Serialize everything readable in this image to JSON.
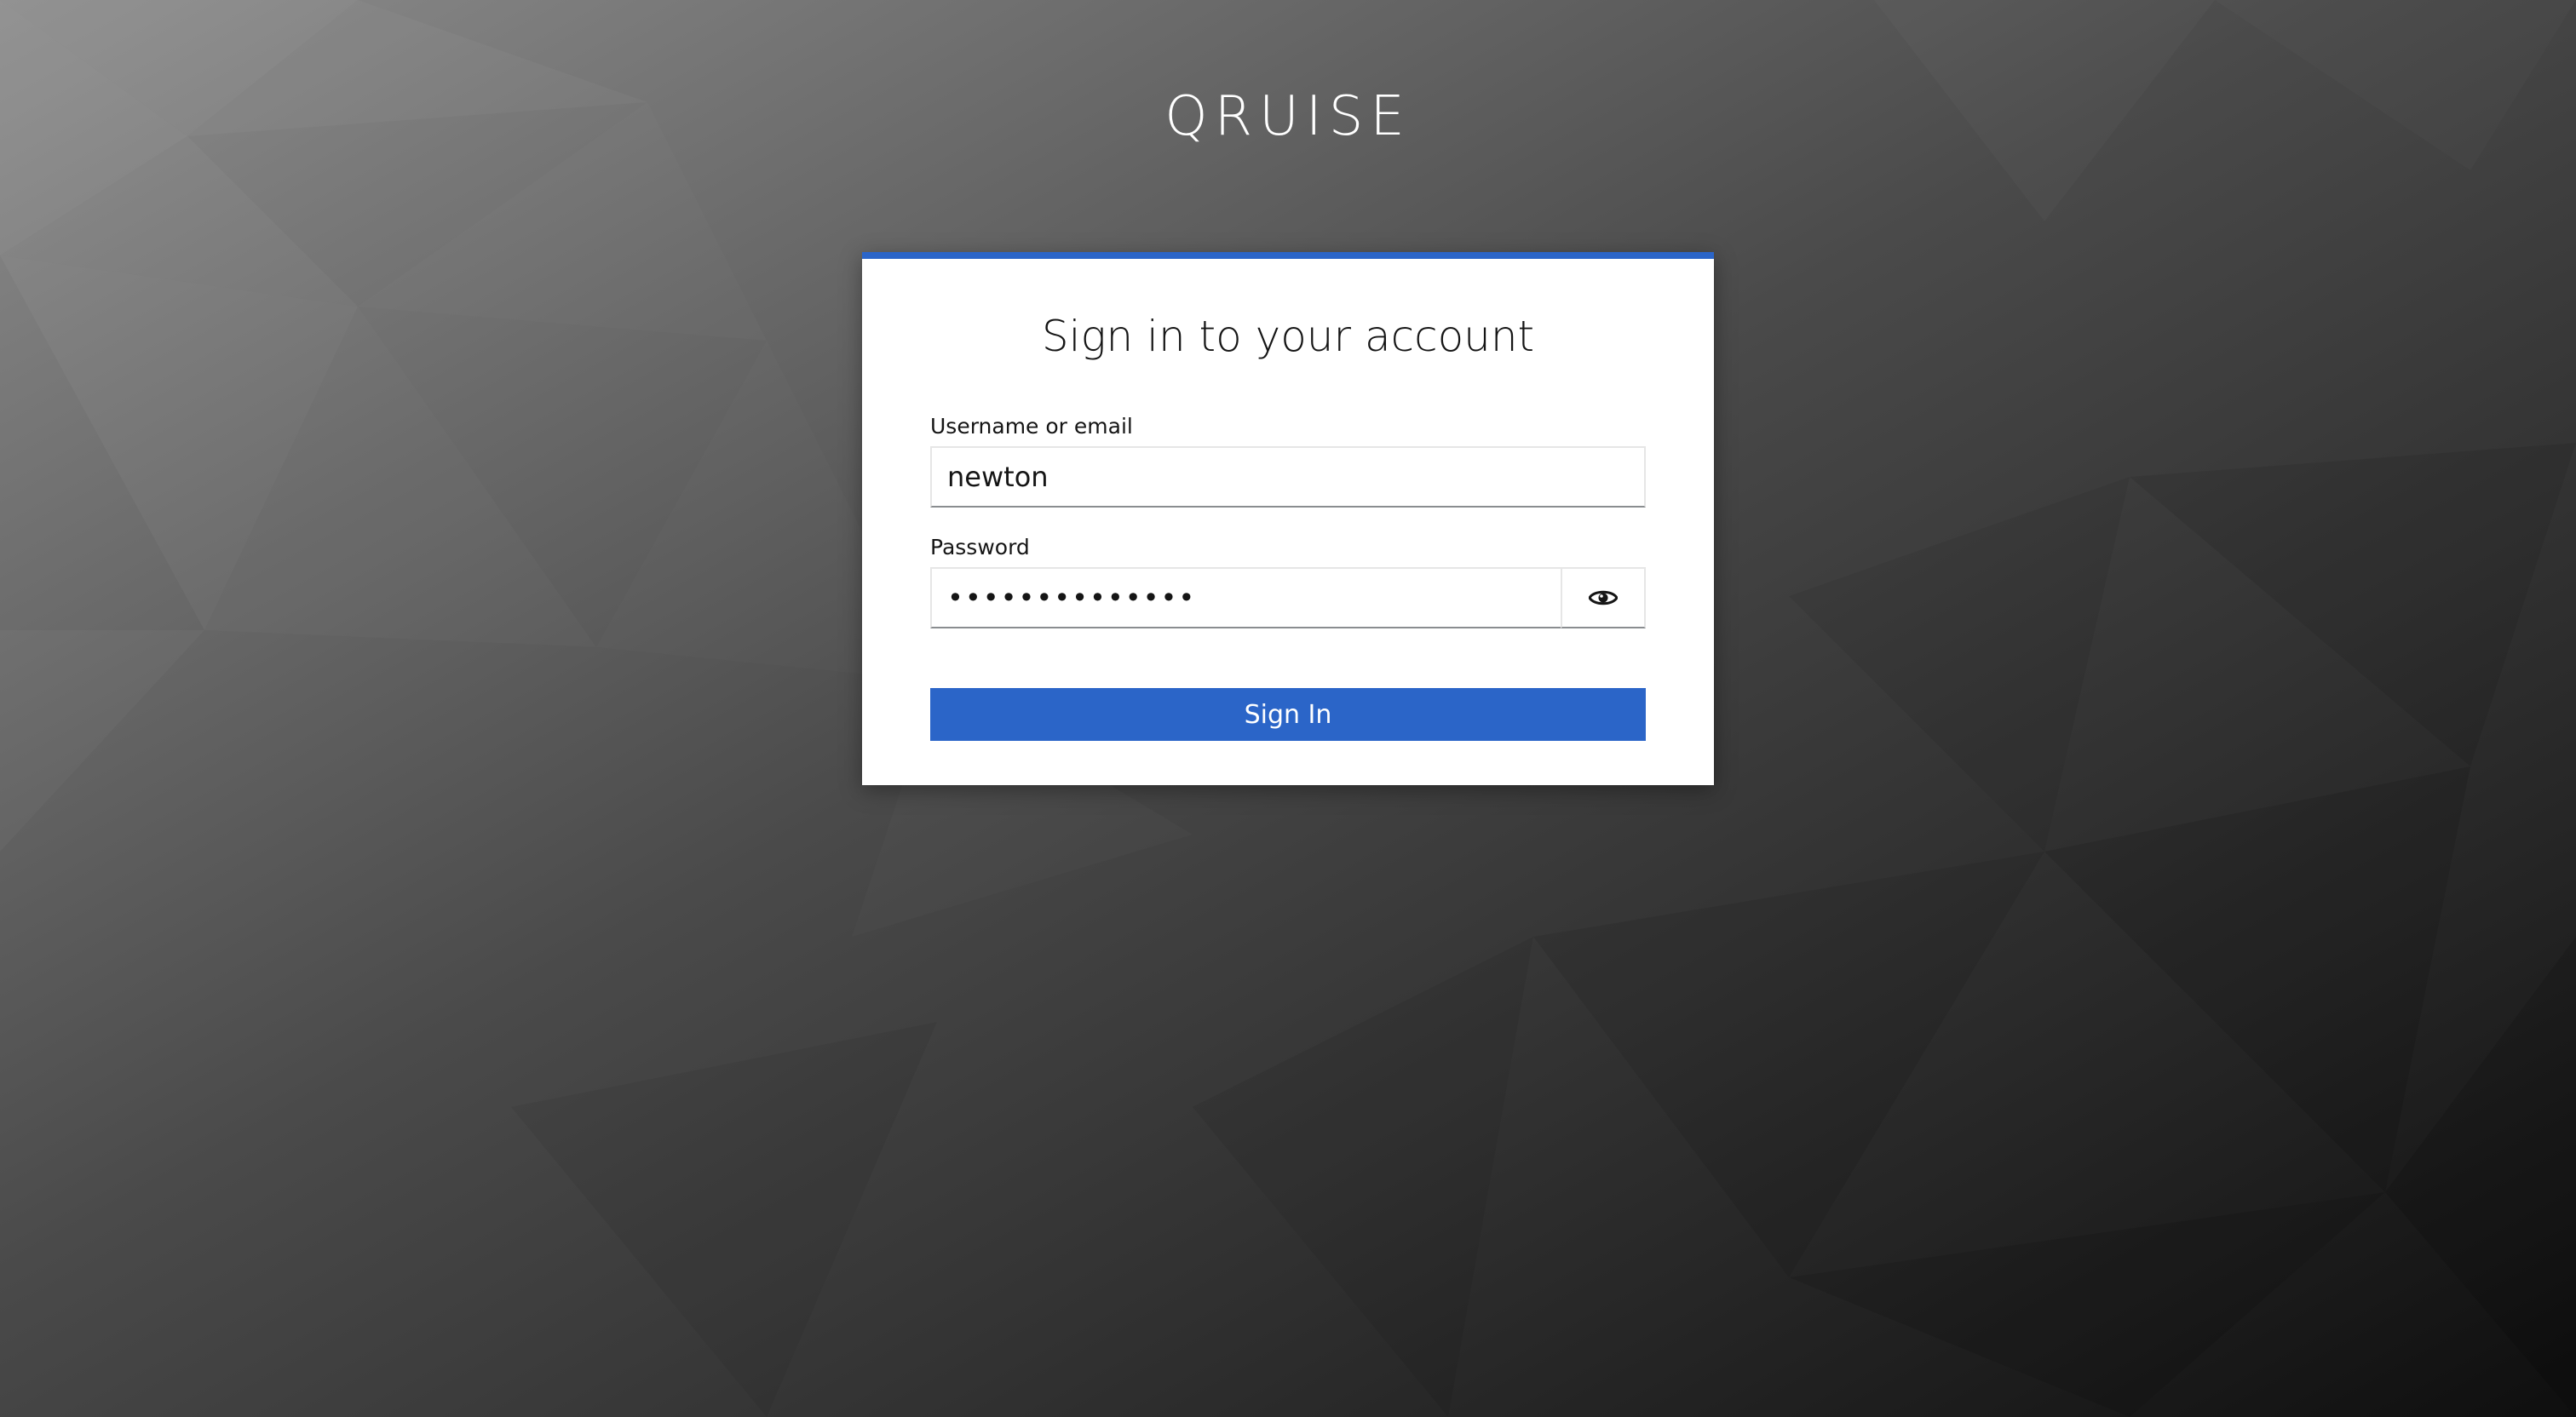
{
  "app": {
    "brand": "QRUISE"
  },
  "login": {
    "title": "Sign in to your account",
    "username_label": "Username or email",
    "username_value": "newton",
    "password_label": "Password",
    "password_value": "••••••••••••••",
    "toggle_icon": "eye-icon",
    "submit_label": "Sign In"
  },
  "colors": {
    "accent": "#2b65c8",
    "background_light": "#8a8a8a",
    "background_dark": "#111111"
  }
}
